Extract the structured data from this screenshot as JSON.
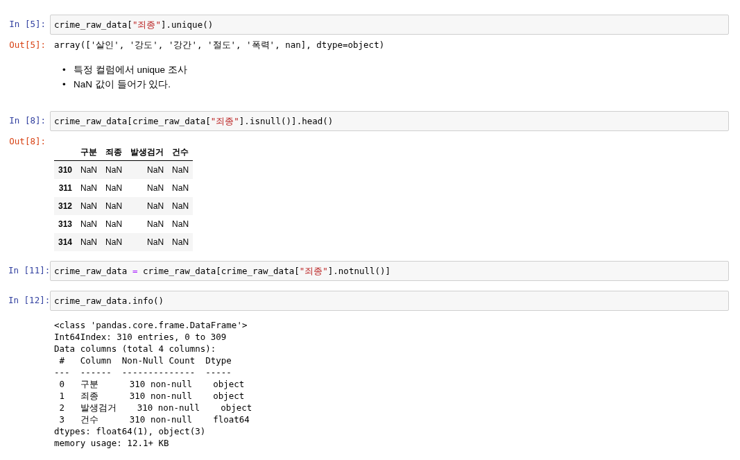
{
  "cells": [
    {
      "kind": "code",
      "prompt": "In [5]:",
      "source": [
        {
          "kind": "plain",
          "text": "crime_raw_data["
        },
        {
          "kind": "string",
          "text": "\"죄종\""
        },
        {
          "kind": "plain",
          "text": "].unique()"
        }
      ],
      "output": {
        "kind": "text",
        "prompt": "Out[5]:",
        "lines": [
          "array(['살인', '강도', '강간', '절도', '폭력', nan], dtype=object)"
        ]
      }
    },
    {
      "kind": "markdown",
      "bullets": [
        {
          "marker": "•",
          "text": "특정 컬럼에서 unique 조사"
        },
        {
          "marker": "•",
          "text": "NaN 값이 들어가 있다."
        }
      ]
    },
    {
      "kind": "code",
      "prompt": "In [8]:",
      "source": [
        {
          "kind": "plain",
          "text": "crime_raw_data[crime_raw_data["
        },
        {
          "kind": "string",
          "text": "\"죄종\""
        },
        {
          "kind": "plain",
          "text": "].isnull()].head()"
        }
      ],
      "output": {
        "kind": "table",
        "prompt": "Out[8]:",
        "columns": [
          "구분",
          "죄종",
          "발생검거",
          "건수"
        ],
        "rows": [
          {
            "index": "310",
            "values": [
              "NaN",
              "NaN",
              "NaN",
              "NaN"
            ]
          },
          {
            "index": "311",
            "values": [
              "NaN",
              "NaN",
              "NaN",
              "NaN"
            ]
          },
          {
            "index": "312",
            "values": [
              "NaN",
              "NaN",
              "NaN",
              "NaN"
            ]
          },
          {
            "index": "313",
            "values": [
              "NaN",
              "NaN",
              "NaN",
              "NaN"
            ]
          },
          {
            "index": "314",
            "values": [
              "NaN",
              "NaN",
              "NaN",
              "NaN"
            ]
          }
        ]
      }
    },
    {
      "kind": "code",
      "prompt": "In [11]:",
      "source": [
        {
          "kind": "plain",
          "text": "crime_raw_data "
        },
        {
          "kind": "operator",
          "text": "="
        },
        {
          "kind": "plain",
          "text": " crime_raw_data[crime_raw_data["
        },
        {
          "kind": "string",
          "text": "\"죄종\""
        },
        {
          "kind": "plain",
          "text": "].notnull()]"
        }
      ]
    },
    {
      "kind": "code",
      "prompt": "In [12]:",
      "source": [
        {
          "kind": "plain",
          "text": "crime_raw_data.info()"
        }
      ],
      "output": {
        "kind": "stream",
        "lines": [
          "<class 'pandas.core.frame.DataFrame'>",
          "Int64Index: 310 entries, 0 to 309",
          "Data columns (total 4 columns):",
          " #   Column  Non-Null Count  Dtype",
          "---  ------  --------------  -----",
          " 0   구분      310 non-null    object",
          " 1   죄종      310 non-null    object",
          " 2   발생검거    310 non-null    object",
          " 3   건수      310 non-null    float64",
          "dtypes: float64(1), object(3)",
          "memory usage: 12.1+ KB"
        ]
      }
    }
  ]
}
